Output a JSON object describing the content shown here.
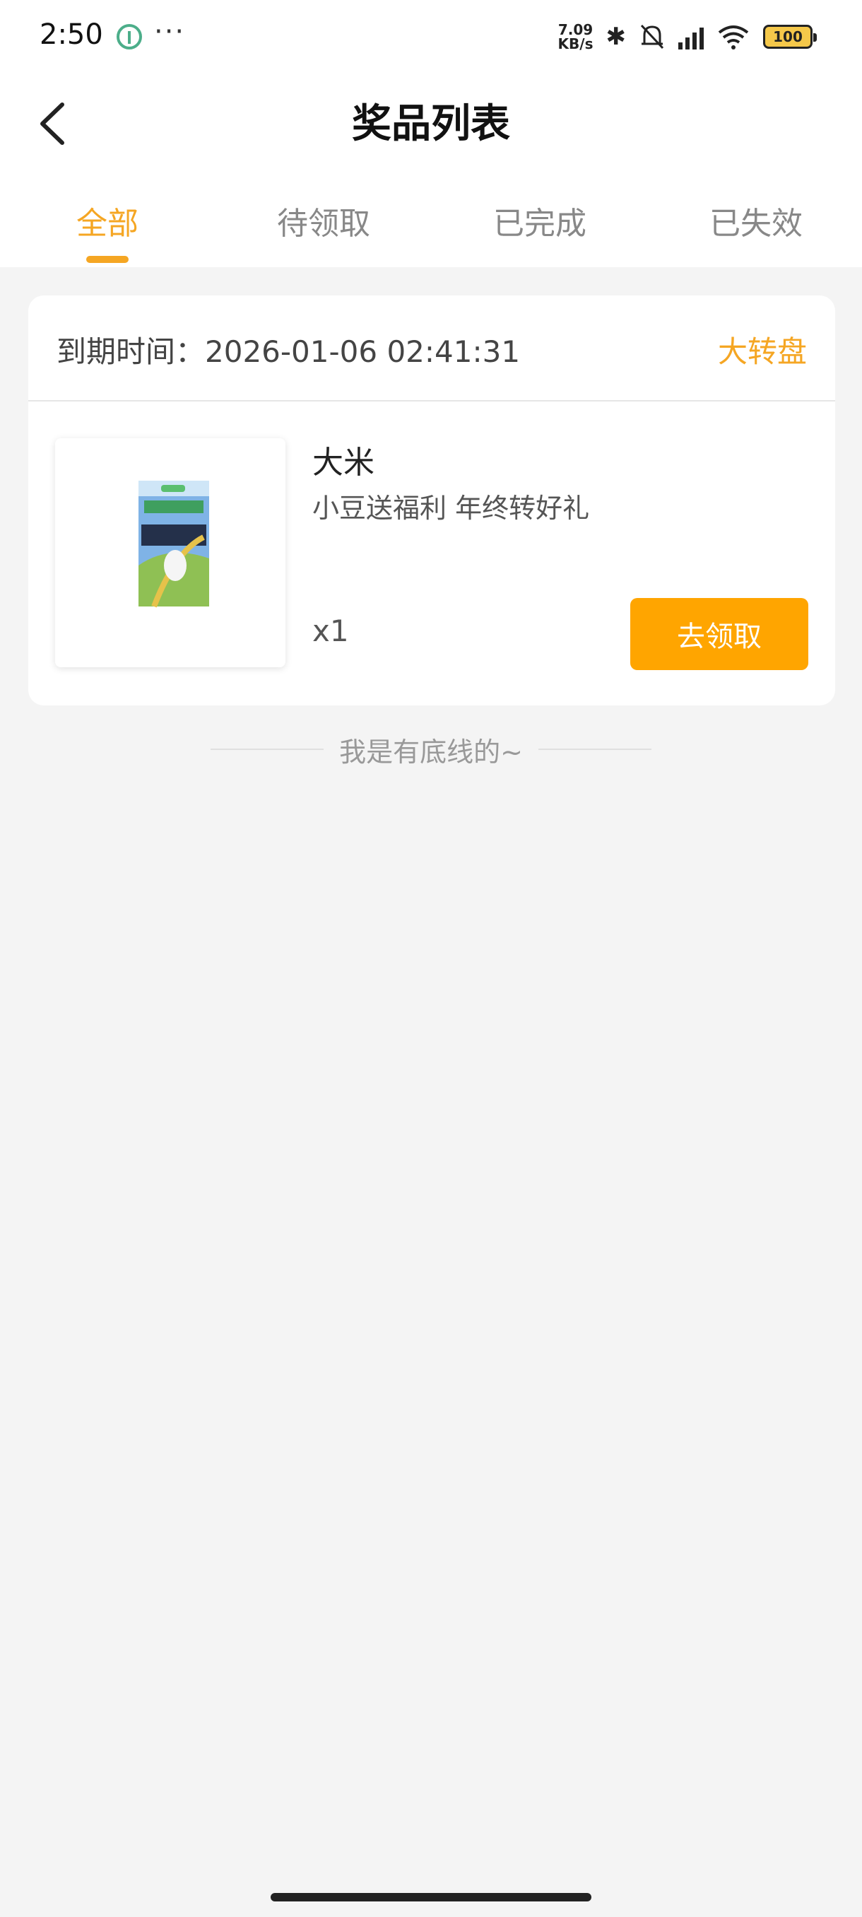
{
  "status_bar": {
    "time": "2:50",
    "more": "···",
    "net_speed_value": "7.09",
    "net_speed_unit": "KB/s",
    "battery": "100",
    "icons": [
      "app-notification-icon",
      "bluetooth-icon",
      "muted-bell-icon",
      "hd-signal-icon",
      "wifi-icon",
      "battery-icon"
    ]
  },
  "header": {
    "title": "奖品列表"
  },
  "tabs": [
    {
      "label": "全部",
      "active": true
    },
    {
      "label": "待领取",
      "active": false
    },
    {
      "label": "已完成",
      "active": false
    },
    {
      "label": "已失效",
      "active": false
    }
  ],
  "prize_card": {
    "expire_label": "到期时间：",
    "expire_time": "2026-01-06 02:41:31",
    "source": "大转盘",
    "name": "大米",
    "description": "小豆送福利 年终转好礼",
    "quantity": "x1",
    "action_label": "去领取"
  },
  "footer": {
    "end_text": "我是有底线的~"
  },
  "colors": {
    "accent": "#f5a623",
    "button": "#ffa500",
    "background": "#f4f4f4"
  }
}
